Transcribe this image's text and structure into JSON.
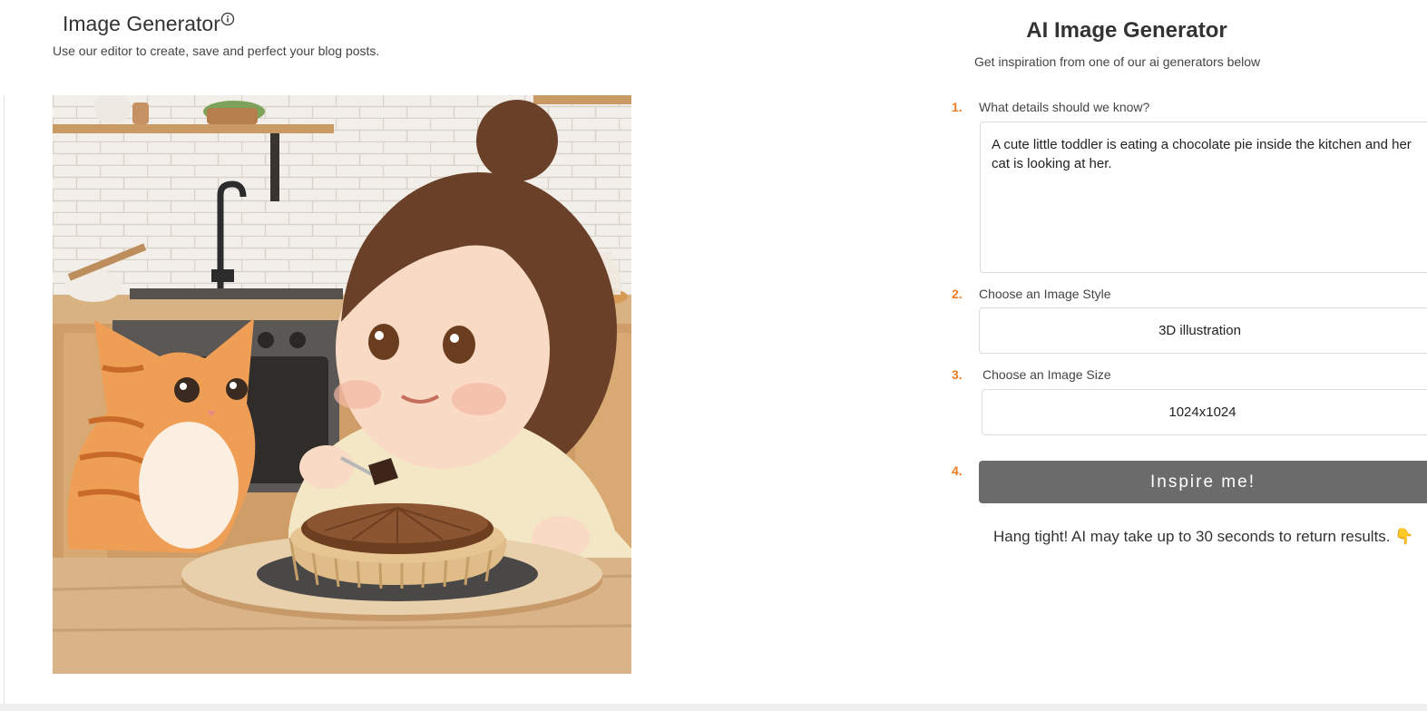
{
  "header": {
    "title": "Image Generator",
    "subtitle": "Use our editor to create, save and perfect your blog posts.",
    "info_icon": "info-circle-icon"
  },
  "preview": {
    "alt": "3D illustration of a toddler eating a chocolate pie in a kitchen while an orange tabby cat watches"
  },
  "generator": {
    "title": "AI Image Generator",
    "subtitle": "Get inspiration from one of our ai generators below",
    "steps": [
      {
        "number": "1.",
        "label": "What details should we know?"
      },
      {
        "number": "2.",
        "label": "Choose an Image Style"
      },
      {
        "number": "3.",
        "label": "Choose an Image Size"
      },
      {
        "number": "4."
      }
    ],
    "prompt_value": "A cute little toddler is eating a chocolate pie inside the kitchen and her cat is looking at her.",
    "style_value": "3D illustration",
    "size_value": "1024x1024",
    "button_label": "Inspire me!",
    "wait_message": "Hang tight! AI may take up to 30 seconds to return results. 👇"
  },
  "colors": {
    "accent_orange": "#f07c22",
    "button_gray": "#6b6b6b",
    "border": "#dcdcdc"
  }
}
